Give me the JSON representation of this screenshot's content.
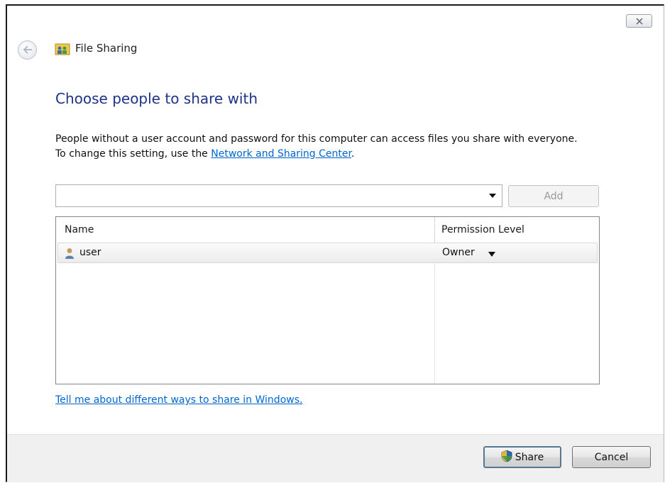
{
  "window": {
    "title": "File Sharing",
    "close_icon": "close-icon",
    "back_icon": "back-arrow-icon"
  },
  "main": {
    "heading": "Choose people to share with",
    "info_line1": "People without a user account and password for this computer can access files you share with everyone.",
    "info_line2_prefix": "To change this setting, use the ",
    "info_link": "Network and Sharing Center",
    "info_line2_suffix": ".",
    "combo_value": "",
    "add_label": "Add"
  },
  "list": {
    "columns": [
      "Name",
      "Permission Level"
    ],
    "rows": [
      {
        "name": "user",
        "permission": "Owner",
        "icon": "user-icon"
      }
    ]
  },
  "help_link": "Tell me about different ways to share in Windows.",
  "footer": {
    "share_label": "Share",
    "cancel_label": "Cancel",
    "shield_icon": "uac-shield-icon"
  },
  "colors": {
    "heading": "#1e3287",
    "link": "#0066cc",
    "footer_bg": "#f0f0f0"
  }
}
